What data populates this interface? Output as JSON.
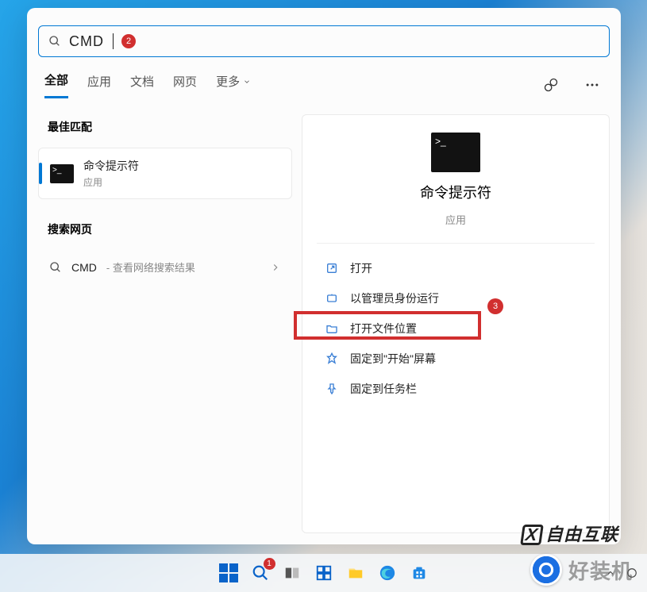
{
  "search": {
    "query": "CMD",
    "badge2": "2"
  },
  "tabs": {
    "all": "全部",
    "apps": "应用",
    "docs": "文档",
    "web": "网页",
    "more": "更多"
  },
  "sections": {
    "best": "最佳匹配",
    "websearch": "搜索网页"
  },
  "result": {
    "title": "命令提示符",
    "subtitle": "应用"
  },
  "websearch": {
    "term": "CMD",
    "hint": " - 查看网络搜索结果"
  },
  "preview": {
    "title": "命令提示符",
    "subtitle": "应用"
  },
  "actions": {
    "open": "打开",
    "run_admin": "以管理员身份运行",
    "open_location": "打开文件位置",
    "pin_start": "固定到\"开始\"屏幕",
    "pin_taskbar": "固定到任务栏"
  },
  "annot": {
    "badge3": "3"
  },
  "taskbar": {
    "search_badge": "1"
  },
  "watermarks": {
    "brand1": "自由互联",
    "brand2": "好装机"
  }
}
